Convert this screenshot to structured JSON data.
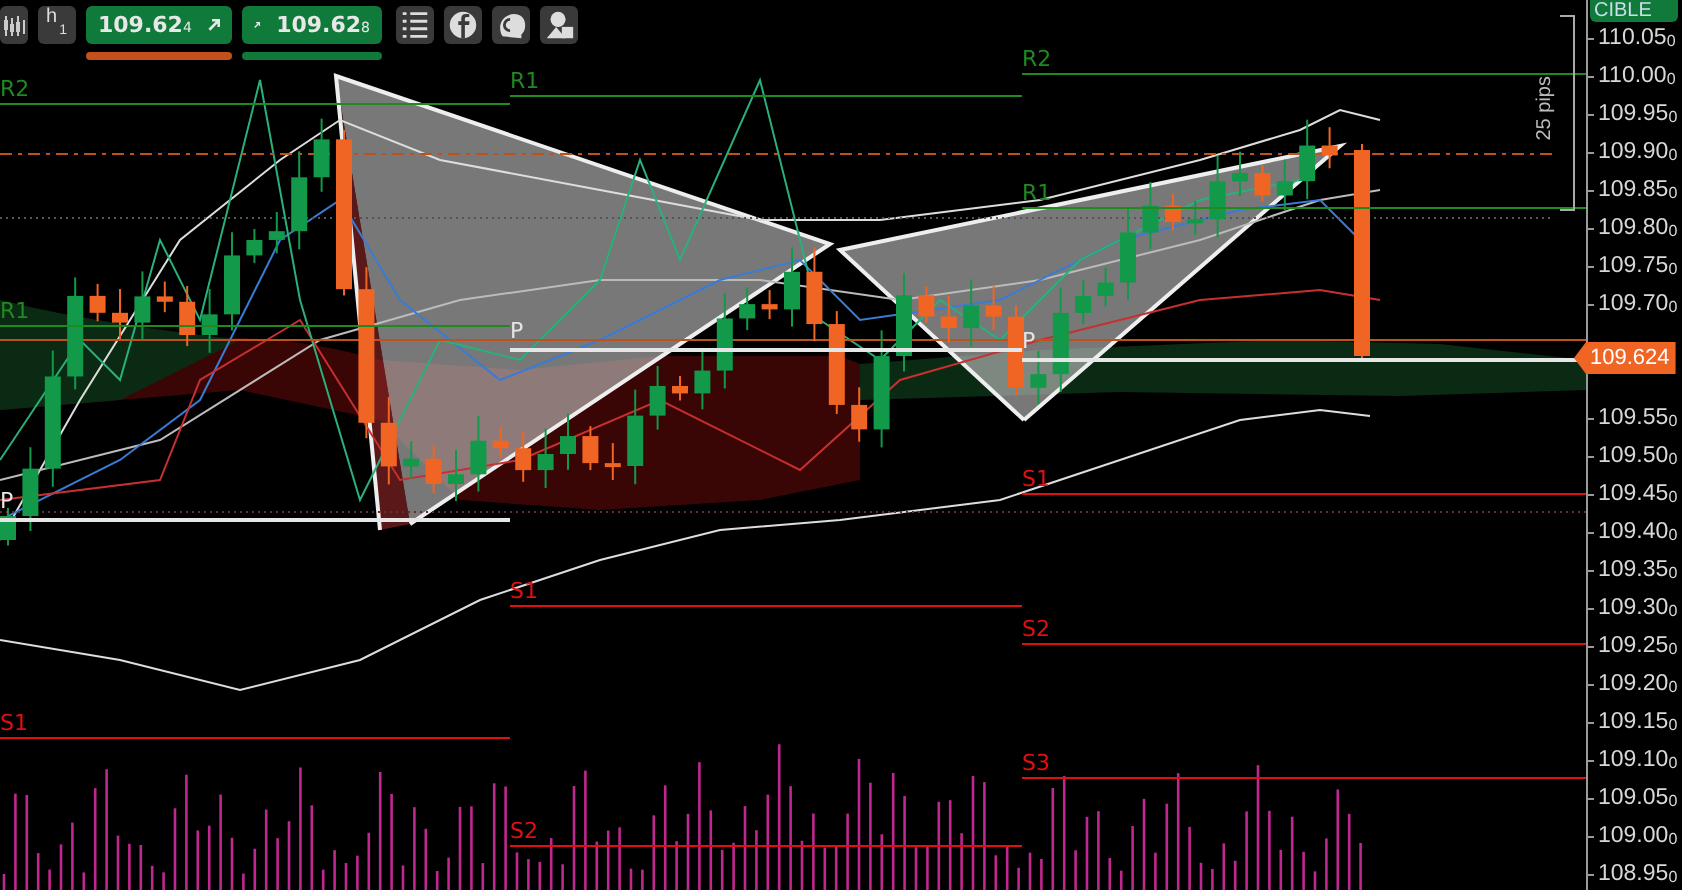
{
  "toolbar": {
    "timeframe": "h",
    "timeframe_sub": "1",
    "sell_button": {
      "price": "109.62$_{4}$"
    },
    "buy_button": {
      "price": "109.62$_{8}$"
    }
  },
  "chart": {
    "target_label": "CIBLE",
    "measure_label": "25 pips",
    "current_price": "109.624",
    "price_axis_upper": [
      "110.05$_{0}$",
      "110.00$_{0}$",
      "109.95$_{0}$",
      "109.90$_{0}$",
      "109.85$_{0}$",
      "109.80$_{0}$",
      "109.75$_{0}$",
      "109.70$_{0}$"
    ],
    "price_axis_lower": [
      "109.55$_{0}$",
      "109.50$_{0}$",
      "109.45$_{0}$",
      "109.40$_{0}$",
      "109.35$_{0}$",
      "109.30$_{0}$",
      "109.25$_{0}$",
      "109.20$_{0}$",
      "109.15$_{0}$",
      "109.10$_{0}$",
      "109.05$_{0}$",
      "109.00$_{0}$",
      "108.95$_{0}$"
    ],
    "pivot_sessions": [
      {
        "levels": [
          {
            "label": "R2",
            "kind": "resistance"
          },
          {
            "label": "R1",
            "kind": "resistance"
          },
          {
            "label": "P",
            "kind": "pivot"
          },
          {
            "label": "S1",
            "kind": "support"
          }
        ]
      },
      {
        "levels": [
          {
            "label": "R1",
            "kind": "resistance"
          },
          {
            "label": "P",
            "kind": "pivot"
          },
          {
            "label": "S1",
            "kind": "support"
          },
          {
            "label": "S2",
            "kind": "support"
          }
        ]
      },
      {
        "levels": [
          {
            "label": "R2",
            "kind": "resistance"
          },
          {
            "label": "R1",
            "kind": "resistance"
          },
          {
            "label": "P",
            "kind": "pivot"
          },
          {
            "label": "S1",
            "kind": "support"
          },
          {
            "label": "S2",
            "kind": "support"
          },
          {
            "label": "S3",
            "kind": "support"
          }
        ]
      }
    ]
  }
}
